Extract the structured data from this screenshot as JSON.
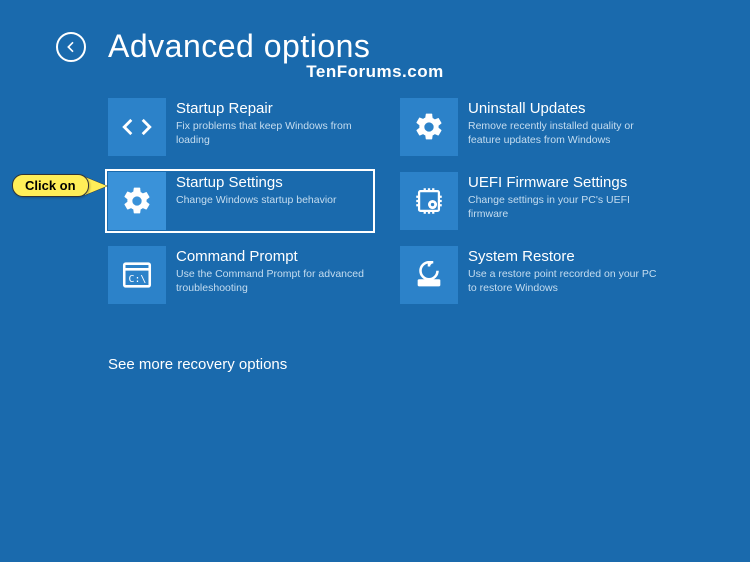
{
  "header": {
    "title": "Advanced options"
  },
  "watermark": "TenForums.com",
  "callout": {
    "text": "Click on"
  },
  "more_link": "See more recovery options",
  "tiles": [
    {
      "title": "Startup Repair",
      "desc": "Fix problems that keep Windows from loading"
    },
    {
      "title": "Uninstall Updates",
      "desc": "Remove recently installed quality or feature updates from Windows"
    },
    {
      "title": "Startup Settings",
      "desc": "Change Windows startup behavior"
    },
    {
      "title": "UEFI Firmware Settings",
      "desc": "Change settings in your PC's UEFI firmware"
    },
    {
      "title": "Command Prompt",
      "desc": "Use the Command Prompt for advanced troubleshooting"
    },
    {
      "title": "System Restore",
      "desc": "Use a restore point recorded on your PC to restore Windows"
    }
  ]
}
